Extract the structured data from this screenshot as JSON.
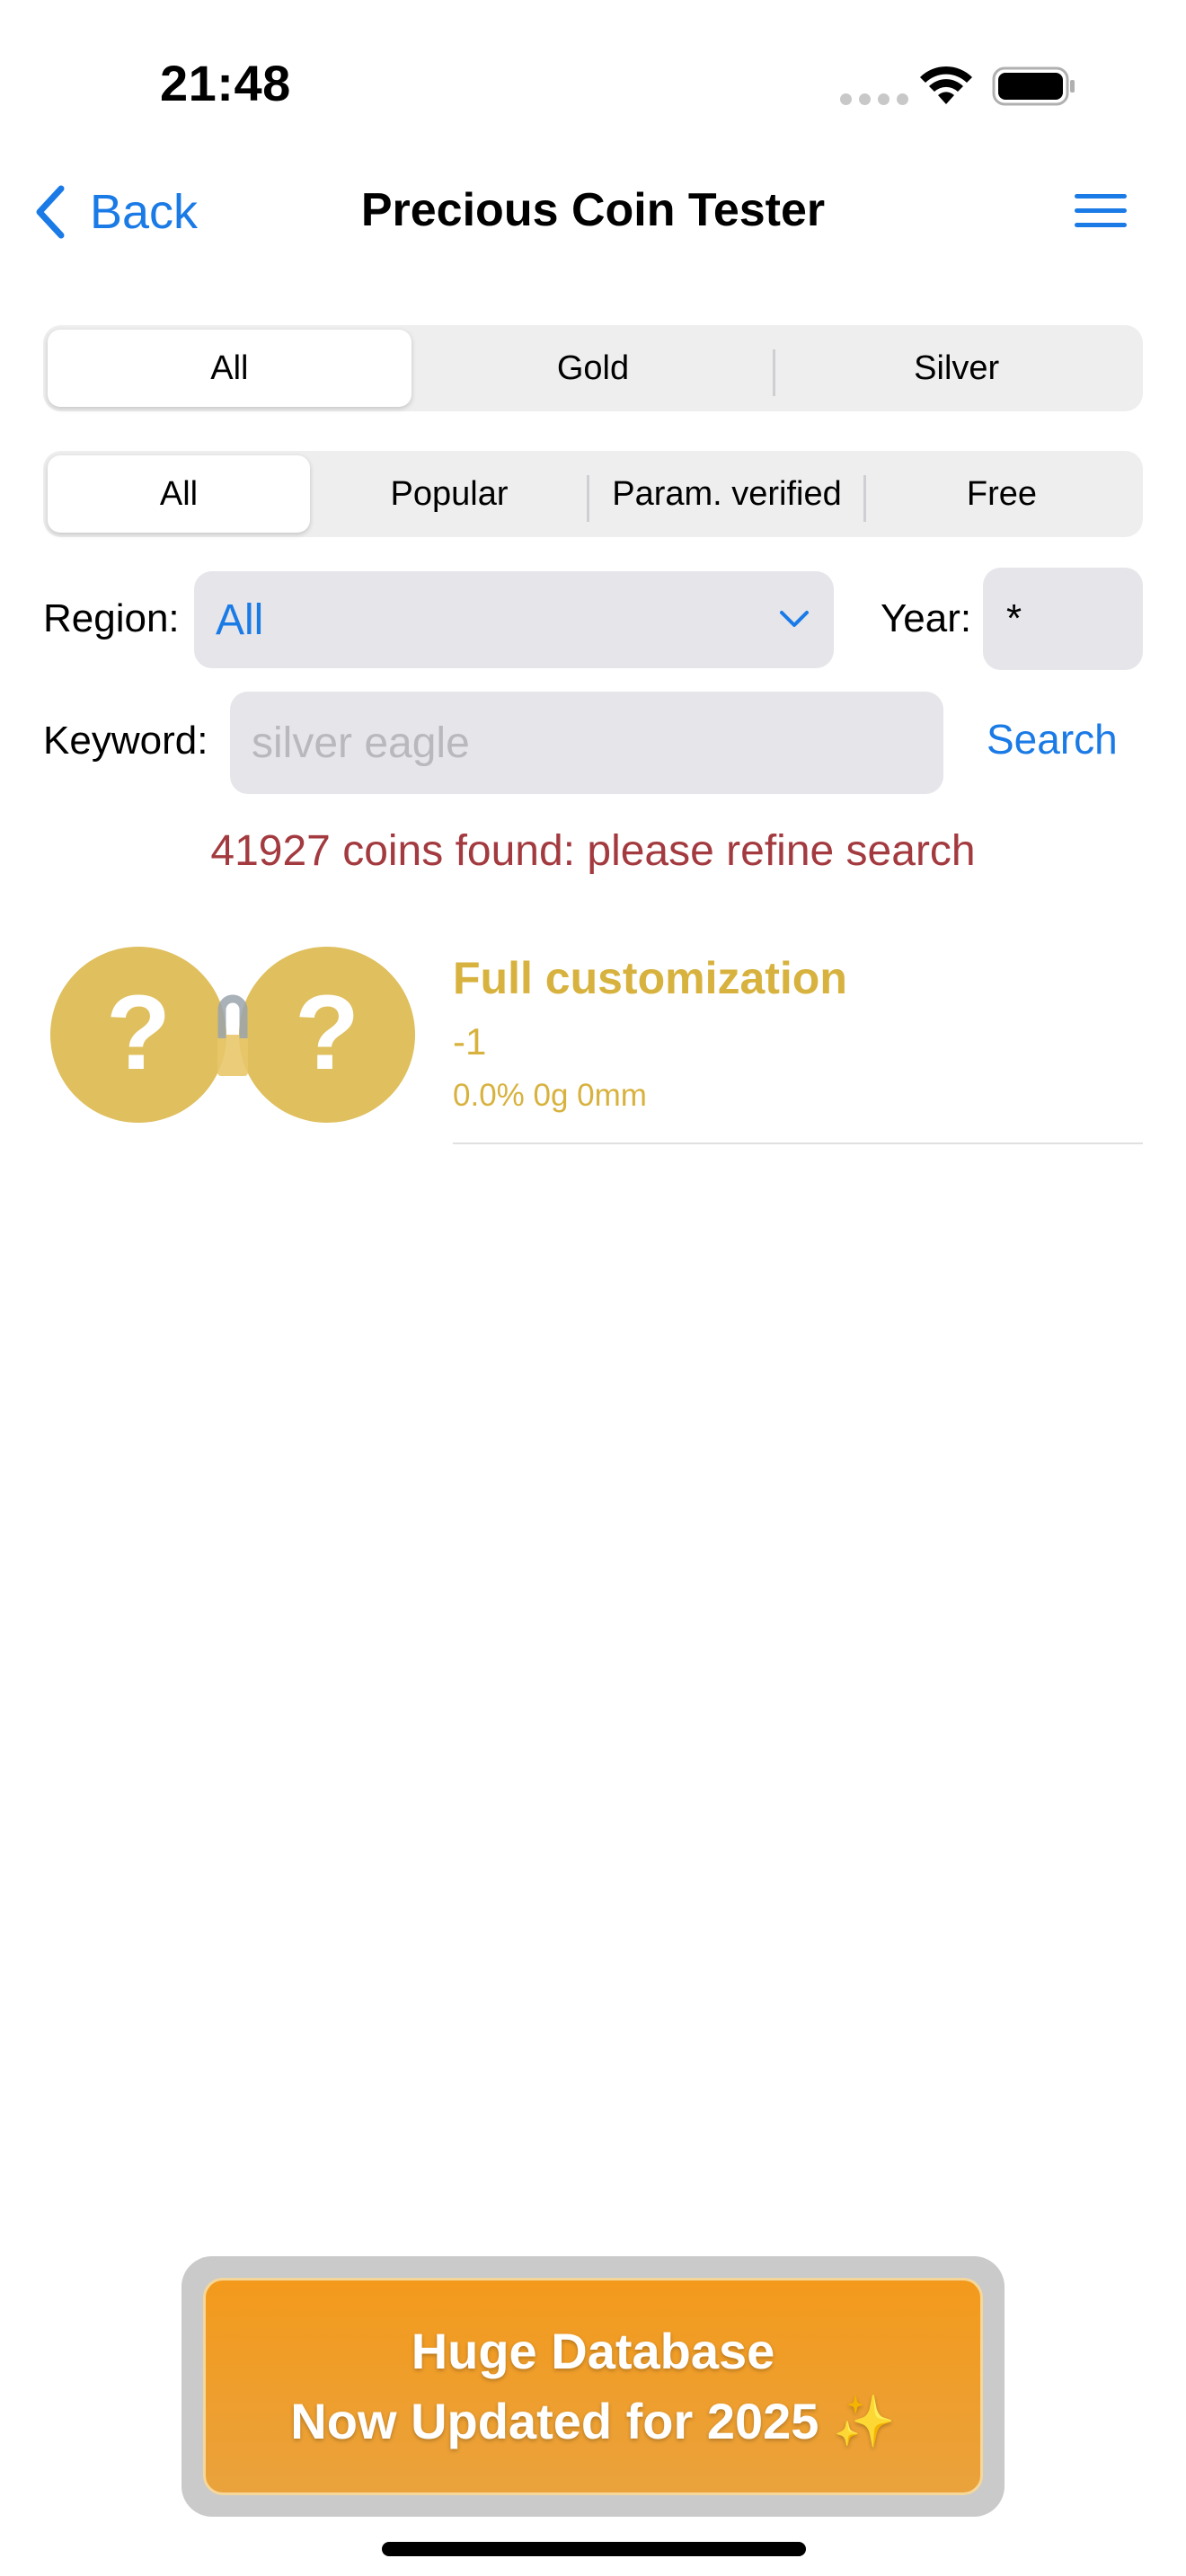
{
  "status_bar": {
    "time": "21:48"
  },
  "nav": {
    "back_label": "Back",
    "title": "Precious Coin Tester"
  },
  "metal_tabs": [
    {
      "label": "All",
      "selected": true
    },
    {
      "label": "Gold",
      "selected": false
    },
    {
      "label": "Silver",
      "selected": false
    }
  ],
  "filter_tabs": [
    {
      "label": "All",
      "selected": true
    },
    {
      "label": "Popular",
      "selected": false
    },
    {
      "label": "Param. verified",
      "selected": false
    },
    {
      "label": "Free",
      "selected": false
    }
  ],
  "filters": {
    "region_label": "Region:",
    "region_value": "All",
    "year_label": "Year:",
    "year_value": "*",
    "keyword_label": "Keyword:",
    "keyword_placeholder": "silver eagle",
    "search_label": "Search"
  },
  "result_message": "41927 coins found: please refine search",
  "coin_item": {
    "title": "Full customization",
    "subtitle": "-1",
    "meta": "0.0% 0g 0mm",
    "image_glyph": "?"
  },
  "promo": {
    "line1": "Huge Database",
    "line2": "Now Updated for 2025 ✨"
  },
  "colors": {
    "accent": "#1a7ae6",
    "gold": "#d8b23e",
    "coin_fill": "#dfbf5e",
    "error": "#a33a3f",
    "promo": "#f39a1c"
  },
  "icons": [
    "wifi-icon",
    "battery-icon",
    "chevron-left-icon",
    "hamburger-menu-icon",
    "chevron-down-icon",
    "coin-placeholder-icon",
    "padlock-icon"
  ]
}
